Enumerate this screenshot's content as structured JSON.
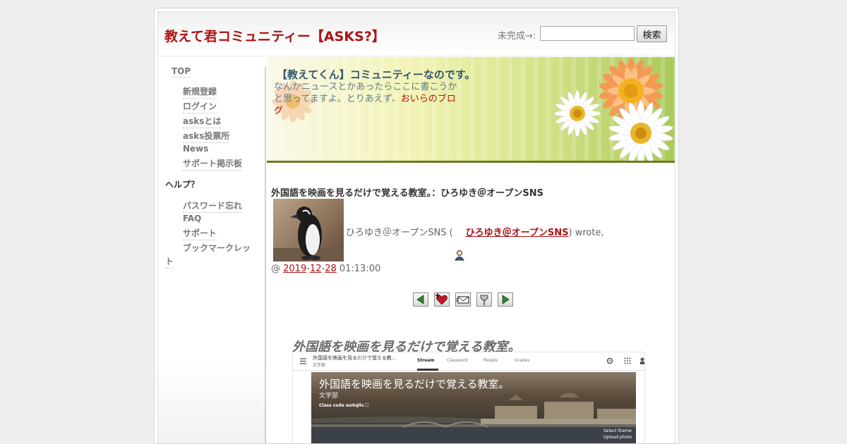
{
  "header": {
    "site_title": "教えて君コミュニティー【ASKS?】",
    "search_label": "未完成→:",
    "search_value": "",
    "search_button": "検索"
  },
  "sidebar": {
    "top": "TOP",
    "main_items": [
      "新規登録",
      "ログイン",
      "asksとは",
      "asks投票所",
      "News",
      "サポート掲示板"
    ],
    "help_heading": "ヘルプ？",
    "help_items": [
      "パスワード忘れ",
      "FAQ",
      "サポート",
      "ブックマークレッ",
      "ト"
    ]
  },
  "banner": {
    "title": "【教えてくん】コミュニティーなのです。",
    "text": "なんかニュースとかあったらここに書こうかと思ってますよ。とりあえず、",
    "link": "おいらのブログ"
  },
  "post": {
    "title": "外国語を映画を見るだけで覚える教室。：ひろゆき＠オープンSNS",
    "author_prefix": "ひろゆき＠オープンSNS (",
    "author_link": "ひろゆき＠オープンSNS",
    "author_suffix": ") wrote,",
    "date_prefix": "@ ",
    "year": "2019",
    "month": "12",
    "day": "28",
    "time": " 01:13:00",
    "sep": "-",
    "toolbar": [
      "previous-entry",
      "add-to-memories",
      "tell-a-friend",
      "track-entry",
      "next-entry"
    ],
    "entry_heading": "外国語を映画を見るだけで覚える教室。"
  },
  "screenshot": {
    "title": "外国語を映画を見るだけで覚える教...",
    "subtitle": "文学部",
    "tabs": [
      "Stream",
      "Classwork",
      "People",
      "Grades"
    ],
    "banner_title": "外国語を映画を見るだけで覚える教室。",
    "banner_subtitle": "文学部",
    "class_code": "Class code  wz6qllo ⛶",
    "select_theme": "Select theme",
    "upload_photo": "Upload photo",
    "chevron": "⌄"
  },
  "colors": {
    "title_red": "#b01212",
    "banner_green": "#d7e48a",
    "banner_border": "#6d7a22"
  }
}
